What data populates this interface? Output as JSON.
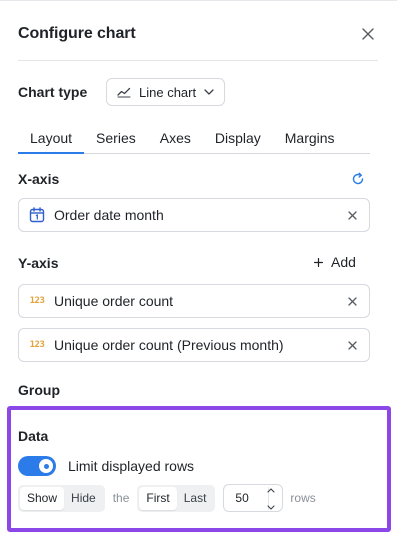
{
  "panel": {
    "title": "Configure chart"
  },
  "chart_type": {
    "label": "Chart type",
    "selected": "Line chart"
  },
  "tabs": [
    "Layout",
    "Series",
    "Axes",
    "Display",
    "Margins"
  ],
  "active_tab": "Layout",
  "x_axis": {
    "label": "X-axis",
    "field": {
      "text": "Order date month",
      "icon": "calendar-icon"
    }
  },
  "y_axis": {
    "label": "Y-axis",
    "add_label": "Add",
    "fields": [
      {
        "text": "Unique order count",
        "icon_text": "123"
      },
      {
        "text": "Unique order count (Previous month)",
        "icon_text": "123"
      }
    ]
  },
  "group": {
    "label": "Group"
  },
  "data": {
    "label": "Data",
    "limit_rows_label": "Limit displayed rows",
    "limit_rows_enabled": true,
    "show_label": "Show",
    "hide_label": "Hide",
    "the_label": "the",
    "first_label": "First",
    "last_label": "Last",
    "rows_value": "50",
    "rows_label": "rows"
  },
  "colors": {
    "accent": "#2b7ce9",
    "highlight_border": "#8b47e8",
    "number_icon": "#e6a23c"
  }
}
